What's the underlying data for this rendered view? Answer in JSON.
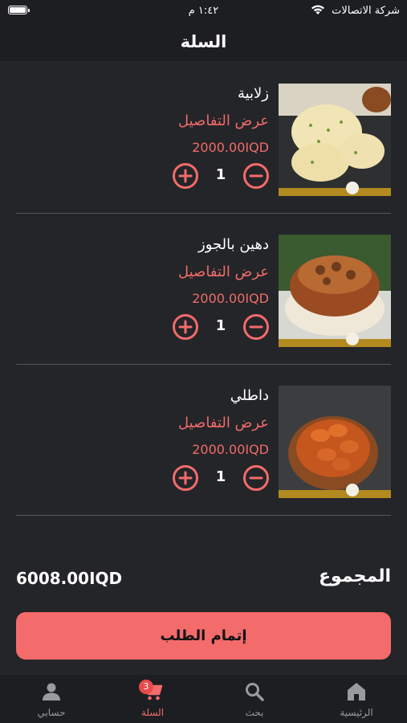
{
  "status_bar": {
    "carrier": "شركة الاتصالات",
    "time": "١:٤٢ م"
  },
  "header": {
    "title": "السلة"
  },
  "cart": {
    "items": [
      {
        "name": "زلابية",
        "details_label": "عرض التفاصيل",
        "price": "2000.00IQD",
        "quantity": "1",
        "image_icon": "zalabia-photo"
      },
      {
        "name": "دهين بالجوز",
        "details_label": "عرض التفاصيل",
        "price": "2000.00IQD",
        "quantity": "1",
        "image_icon": "dehen-walnut-photo"
      },
      {
        "name": "داطلي",
        "details_label": "عرض التفاصيل",
        "price": "2000.00IQD",
        "quantity": "1",
        "image_icon": "datli-photo"
      }
    ]
  },
  "total": {
    "label": "المجموع",
    "value": "6008.00IQD"
  },
  "checkout": {
    "label": "إتمام الطلب"
  },
  "tab_bar": {
    "tabs": [
      {
        "label": "الرئيسية",
        "icon": "home-icon"
      },
      {
        "label": "بحث",
        "icon": "search-icon"
      },
      {
        "label": "السلة",
        "icon": "cart-icon",
        "badge": "3",
        "active": true
      },
      {
        "label": "حسابي",
        "icon": "person-icon"
      }
    ]
  },
  "colors": {
    "accent": "#f36b6b",
    "background": "#242528",
    "bar": "#1d1e21"
  }
}
